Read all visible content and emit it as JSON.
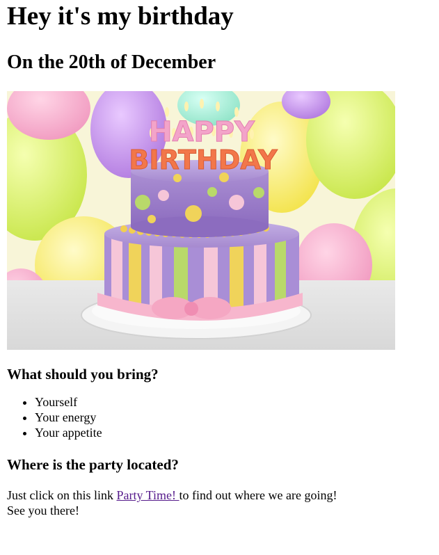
{
  "page": {
    "title": "Hey it's my birthday",
    "subtitle": "On the 20th of December"
  },
  "image": {
    "cake_topper_line1": "HAPPY",
    "cake_topper_line2": "BIRTHDAY"
  },
  "bring": {
    "heading": "What should you bring?",
    "items": [
      "Yourself",
      "Your energy",
      "Your appetite"
    ]
  },
  "location": {
    "heading": "Where is the party located?",
    "text_before": "Just click on this link ",
    "link_label": "Party Time! ",
    "text_after": "to find out where we are going!",
    "closing": "See you there!"
  },
  "colors": {
    "link_visited": "#551a8b",
    "text": "#000000",
    "background": "#ffffff"
  }
}
